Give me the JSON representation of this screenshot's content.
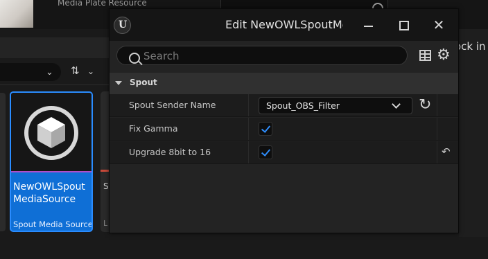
{
  "background": {
    "media_plate_label": "Media Plate Resource",
    "lock_in_text": "ock in",
    "asset": {
      "name": "NewOWLSpout MediaSource",
      "type": "Spout Media Source"
    },
    "partial_asset": {
      "initial": "S",
      "initial_type": "L"
    }
  },
  "dialog": {
    "title": "Edit NewOWLSpoutMe",
    "search": {
      "placeholder": "Search",
      "value": ""
    },
    "category": "Spout",
    "properties": [
      {
        "name": "Spout Sender Name",
        "value": "Spout_OBS_Filter"
      },
      {
        "name": "Fix Gamma",
        "checked": true
      },
      {
        "name": "Upgrade 8bit to 16",
        "checked": true
      }
    ]
  },
  "icons": {
    "logo": "unreal-logo-icon",
    "search": "search-icon",
    "table": "table-icon",
    "settings": "gear-icon",
    "refresh": "refresh-icon",
    "reset": "reset-arrow-icon",
    "sort": "sort-icon"
  },
  "colors": {
    "accent": "#0f6fd6",
    "checkmark": "#2f8fff",
    "dialog_bg": "#232323"
  }
}
